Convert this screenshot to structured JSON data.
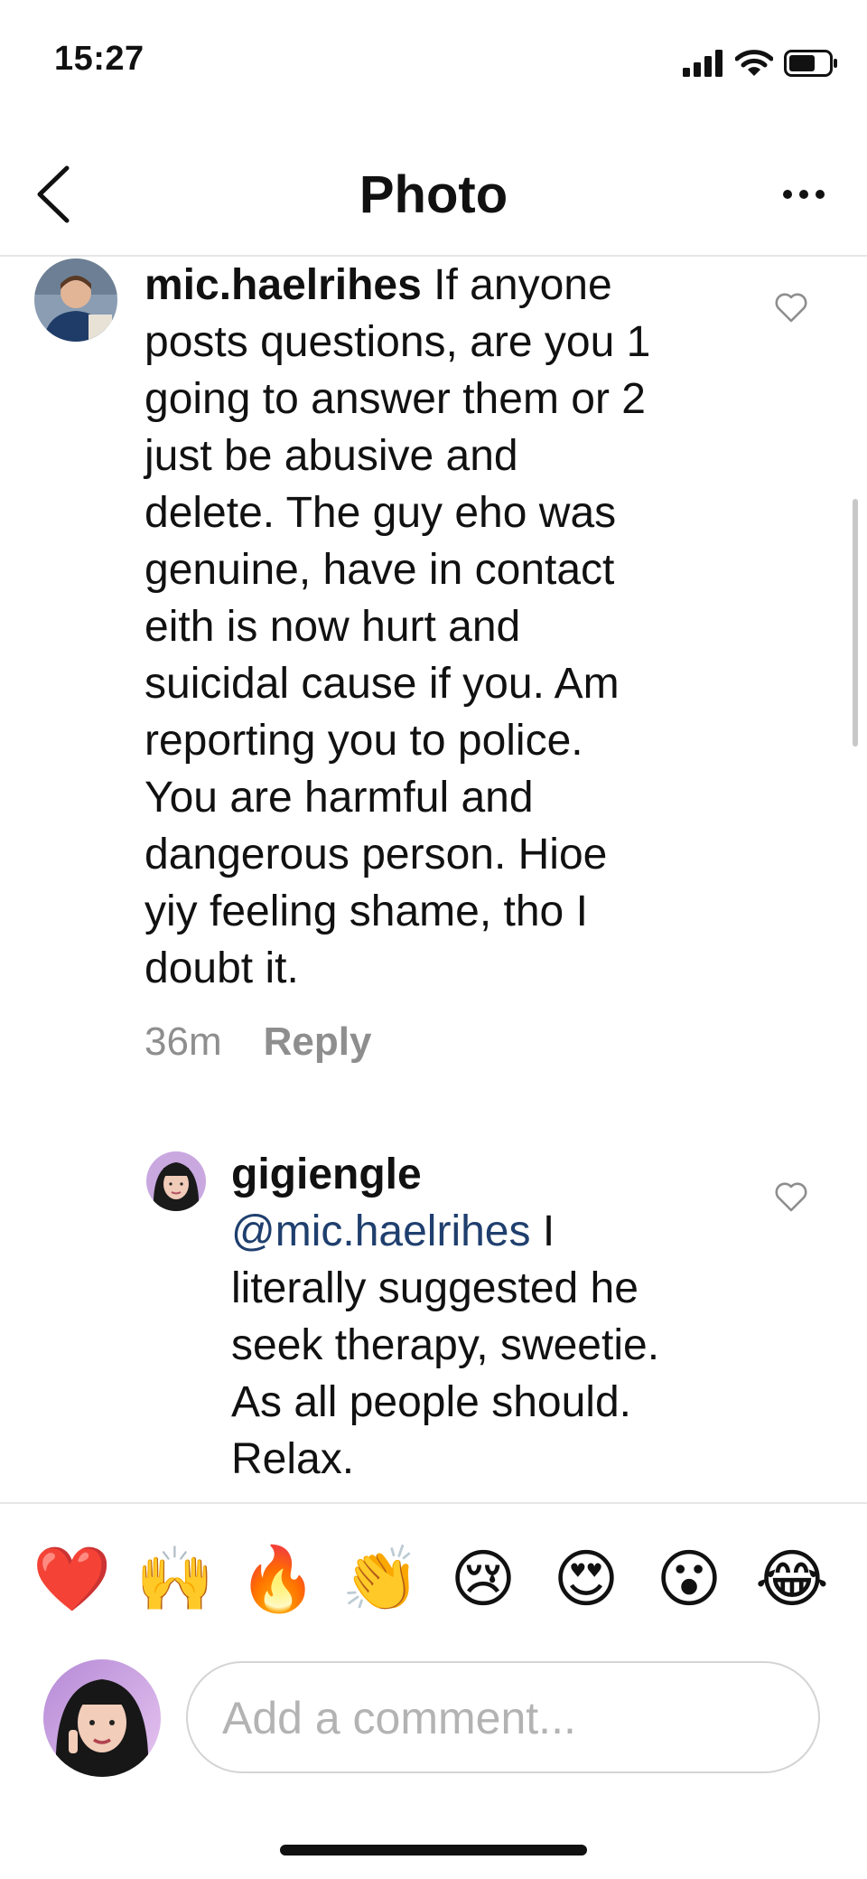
{
  "status_bar": {
    "time": "15:27"
  },
  "nav": {
    "title": "Photo"
  },
  "comments": [
    {
      "username": "mic.haelrihes",
      "lines": [
        "If anyone",
        "posts questions, are you 1",
        "going to answer them or 2",
        "just be abusive and",
        "delete. The guy eho was",
        "genuine, have in contact",
        "eith is now hurt and",
        "suicidal cause if you. Am",
        "reporting you to police.",
        "You are harmful and",
        "dangerous person. Hioe",
        "yiy feeling shame, tho I",
        "doubt it."
      ],
      "time": "36m",
      "reply_label": "Reply"
    },
    {
      "username": "gigiengle",
      "mention": "@mic.haelrihes",
      "lines": [
        "I",
        "literally suggested he",
        "seek therapy, sweetie.",
        "As all people should.",
        "Relax."
      ]
    }
  ],
  "emoji_bar": [
    "❤️",
    "🙌",
    "🔥",
    "👏",
    "😢",
    "😍",
    "😮",
    "😂"
  ],
  "composer": {
    "placeholder": "Add a comment..."
  },
  "colors": {
    "mention": "#1f3f6e",
    "meta": "#8e8e8e",
    "divider": "#e6e6e6"
  }
}
